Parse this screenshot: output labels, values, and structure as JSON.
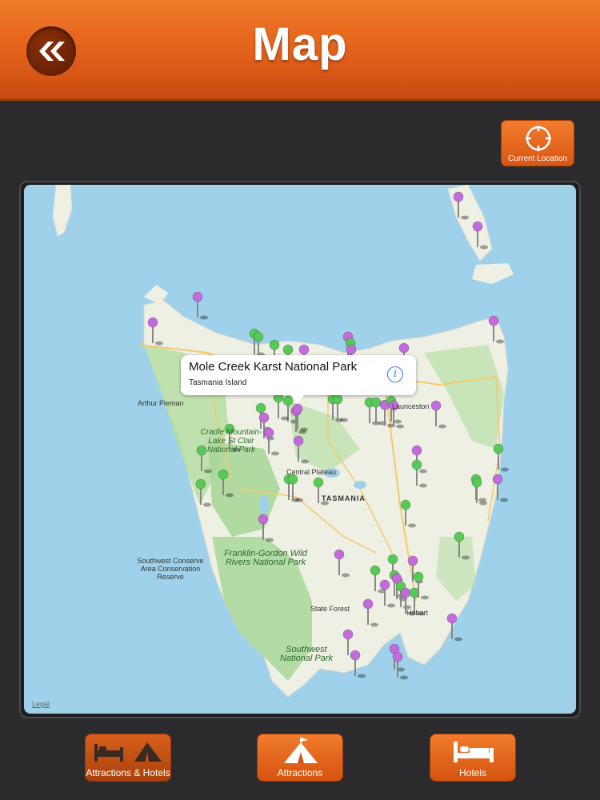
{
  "header": {
    "title": "Map"
  },
  "toolbar": {
    "current_location_label": "Current Location"
  },
  "map": {
    "legal": "Legal",
    "labels": [
      {
        "id": "tasmania",
        "text": "TASMANIA"
      },
      {
        "id": "central-plateau",
        "text": "Central Plateau"
      },
      {
        "id": "arthur-pieman",
        "text": "Arthur Pieman"
      },
      {
        "id": "launceston",
        "text": "Launceston"
      },
      {
        "id": "hobart",
        "text": "Hobart"
      },
      {
        "id": "state-forest",
        "text": "State Forest"
      },
      {
        "id": "southwest-conserve",
        "text": "Southwest Conserve Area Conservation Reserve"
      }
    ],
    "parks": [
      {
        "id": "cradle",
        "text": "Cradle Mountain-Lake St Clair National Park"
      },
      {
        "id": "franklin",
        "text": "Franklin-Gordon Wild Rivers National Park"
      },
      {
        "id": "southwest",
        "text": "Southwest National Park"
      }
    ],
    "callout": {
      "title": "Mole Creek Karst National Park",
      "subtitle": "Tasmania Island"
    }
  },
  "tabs": [
    {
      "label": "Attractions & Hotels",
      "selected": true
    },
    {
      "label": "Attractions",
      "selected": false
    },
    {
      "label": "Hotels",
      "selected": false
    }
  ],
  "colors": {
    "accent": "#e2601a",
    "water": "#9fd2ea",
    "land": "#eef0e4",
    "park": "#a8d89a",
    "pin_purple": "#c36bdc",
    "pin_green": "#57c957"
  }
}
